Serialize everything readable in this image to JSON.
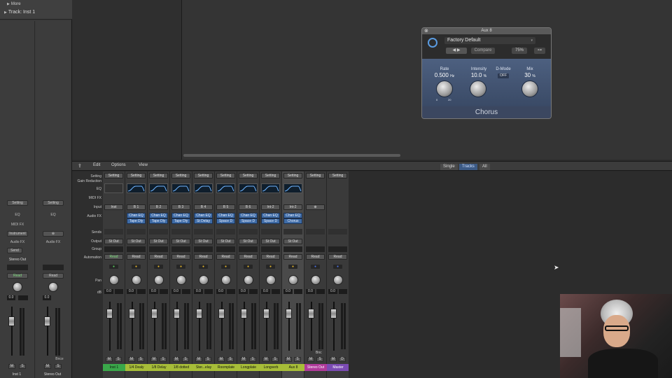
{
  "inspector": {
    "more_label": "More",
    "track_label": "Track:",
    "track_name": "Inst 1",
    "strip1": {
      "setting": "Setting",
      "eq": "EQ",
      "midi_fx": "MIDI FX",
      "instrument": "Instrument",
      "audio_fx": "Audio FX",
      "send": "Send",
      "output": "Stereo Out",
      "automation": "Read",
      "value": "0.0",
      "mute": "M",
      "solo": "S",
      "name": "Inst 1"
    },
    "strip2": {
      "setting": "Setting",
      "eq": "EQ",
      "audio_fx": "Audio FX",
      "automation": "Read",
      "value": "0.0",
      "bounce": "Bnce",
      "mute": "M",
      "solo": "S",
      "name": "Stereo Out"
    }
  },
  "plugin": {
    "window_title": "Aux 8",
    "preset": "Factory Default",
    "compare": "Compare",
    "zoom": "75%",
    "params": {
      "rate": {
        "label": "Rate",
        "value": "0.500",
        "unit": "Hz",
        "min": "0",
        "max": "20"
      },
      "intensity": {
        "label": "Intensity",
        "value": "10.0",
        "unit": "%"
      },
      "dmode": {
        "label": "D-Mode",
        "value": "OFF"
      },
      "mix": {
        "label": "Mix",
        "value": "30",
        "unit": "%"
      }
    },
    "name": "Chorus"
  },
  "mixer_bar": {
    "edit": "Edit",
    "options": "Options",
    "view": "View",
    "views": [
      "Single",
      "Tracks",
      "All"
    ],
    "active_view": "Tracks"
  },
  "row_labels": {
    "setting": "Setting",
    "gain": "Gain Reduction",
    "eq": "EQ",
    "midi_fx": "MIDI FX",
    "input": "Input",
    "audio_fx": "Audio FX",
    "sends": "Sends",
    "output": "Output",
    "group": "Group",
    "automation": "Automation",
    "pan": "Pan",
    "db": "dB"
  },
  "channels": [
    {
      "name": "Inst 1",
      "input": "Inst",
      "fx": [],
      "output": "St Out",
      "auto": "Read",
      "db": "0.0",
      "color": "#3aa84a"
    },
    {
      "name": "1/4 Dealy",
      "input": "B 1",
      "fx": [
        "Chan EQ",
        "Tape Dly"
      ],
      "output": "St Out",
      "auto": "Read",
      "db": "0.0",
      "color": "#a7bd38"
    },
    {
      "name": "1/8 Delay",
      "input": "B 2",
      "fx": [
        "Chan EQ",
        "Tape Dly"
      ],
      "output": "St Out",
      "auto": "Read",
      "db": "0.0",
      "color": "#a7bd38"
    },
    {
      "name": "1/8 dotted",
      "input": "B 3",
      "fx": [
        "Chan EQ",
        "Tape Dly"
      ],
      "output": "St Out",
      "auto": "Read",
      "db": "0.0",
      "color": "#a7bd38"
    },
    {
      "name": "Ster...elay",
      "input": "B 4",
      "fx": [
        "Chan EQ",
        "St Delay"
      ],
      "output": "St Out",
      "auto": "Read",
      "db": "0.0",
      "color": "#a7bd38"
    },
    {
      "name": "Roomplate",
      "input": "B 5",
      "fx": [
        "Chan EQ",
        "Space D"
      ],
      "output": "St Out",
      "auto": "Read",
      "db": "0.0",
      "color": "#a7bd38"
    },
    {
      "name": "Longplate",
      "input": "B 6",
      "fx": [
        "Chan EQ",
        "Space D"
      ],
      "output": "St Out",
      "auto": "Read",
      "db": "0.0",
      "color": "#a7bd38"
    },
    {
      "name": "Longverb",
      "input": "Int-2",
      "fx": [
        "Chan EQ",
        "Space D"
      ],
      "output": "St Out",
      "auto": "Read",
      "db": "0.0",
      "color": "#a7bd38"
    },
    {
      "name": "Aux 8",
      "input": "Int-2",
      "fx": [
        "Chan EQ",
        "Chorus"
      ],
      "output": "St Out",
      "auto": "Read",
      "db": "0.0",
      "color": "#a7bd38"
    },
    {
      "name": "Stereo Out",
      "input": "",
      "fx": [],
      "output": "",
      "auto": "Read",
      "db": "0.0",
      "color": "#b03a9a",
      "bounce": "Bnc"
    },
    {
      "name": "Master",
      "input": "",
      "fx": [],
      "output": "",
      "auto": "Read",
      "db": "0.0",
      "color": "#7b4bb3"
    }
  ],
  "mute_label": "M",
  "solo_label": "S",
  "dim_label": "D",
  "setting_label": "Setting"
}
